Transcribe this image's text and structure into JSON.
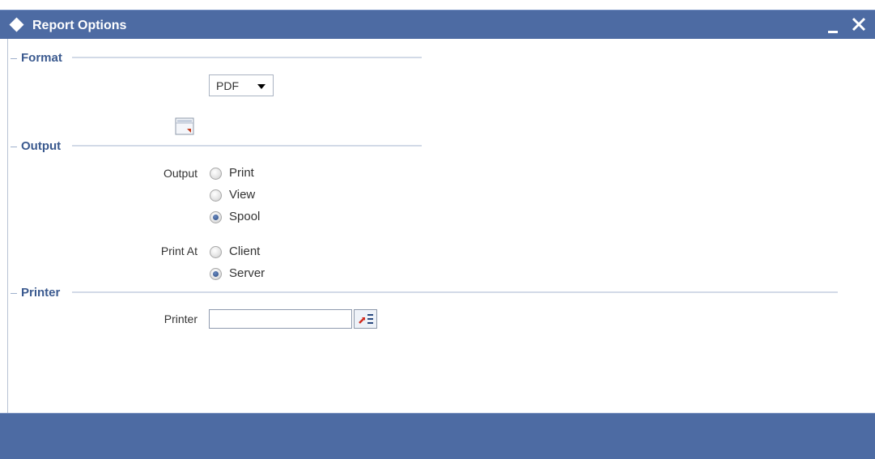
{
  "window": {
    "title": "Report Options",
    "accent_color": "#4d6ba3",
    "icons": {
      "title": "diamond-icon",
      "minimize": "minimize-icon",
      "close": "close-icon"
    }
  },
  "format_section": {
    "legend": "Format",
    "format_select": {
      "selected": "PDF"
    },
    "settings_button_icon": "page-settings-icon"
  },
  "output_section": {
    "legend": "Output",
    "output_label": "Output",
    "output_options": [
      {
        "label": "Print",
        "checked": false
      },
      {
        "label": "View",
        "checked": false
      },
      {
        "label": "Spool",
        "checked": true
      }
    ],
    "print_at_label": "Print At",
    "print_at_options": [
      {
        "label": "Client",
        "checked": false
      },
      {
        "label": "Server",
        "checked": true
      }
    ]
  },
  "printer_section": {
    "legend": "Printer",
    "printer_label": "Printer",
    "printer_value": "",
    "lov_icon": "list-of-values-icon"
  }
}
